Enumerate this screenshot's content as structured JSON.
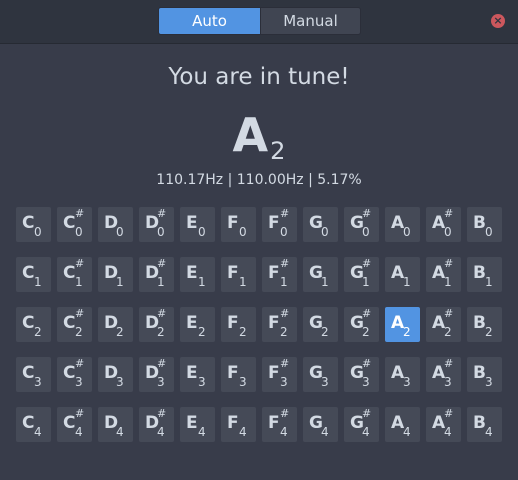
{
  "header": {
    "modes": [
      "Auto",
      "Manual"
    ],
    "active_mode": "Auto",
    "close_icon": "close-icon",
    "close_glyph": "×"
  },
  "tuner": {
    "status": "You are in tune!",
    "note": {
      "letter": "A",
      "octave": "2"
    },
    "frequency_readout": "110.17Hz | 110.00Hz | 5.17%"
  },
  "note_grid": {
    "sharp_symbol": "#",
    "notes": [
      "C",
      "C#",
      "D",
      "D#",
      "E",
      "F",
      "F#",
      "G",
      "G#",
      "A",
      "A#",
      "B"
    ],
    "octaves": [
      "0",
      "1",
      "2",
      "3",
      "4"
    ],
    "selected": {
      "note": "A",
      "octave": "2"
    }
  },
  "colors": {
    "accent": "#5294e2",
    "window_bg": "#383c4a",
    "titlebar_bg": "#2f343f",
    "key_bg": "#454a57",
    "close": "#cc575d"
  }
}
